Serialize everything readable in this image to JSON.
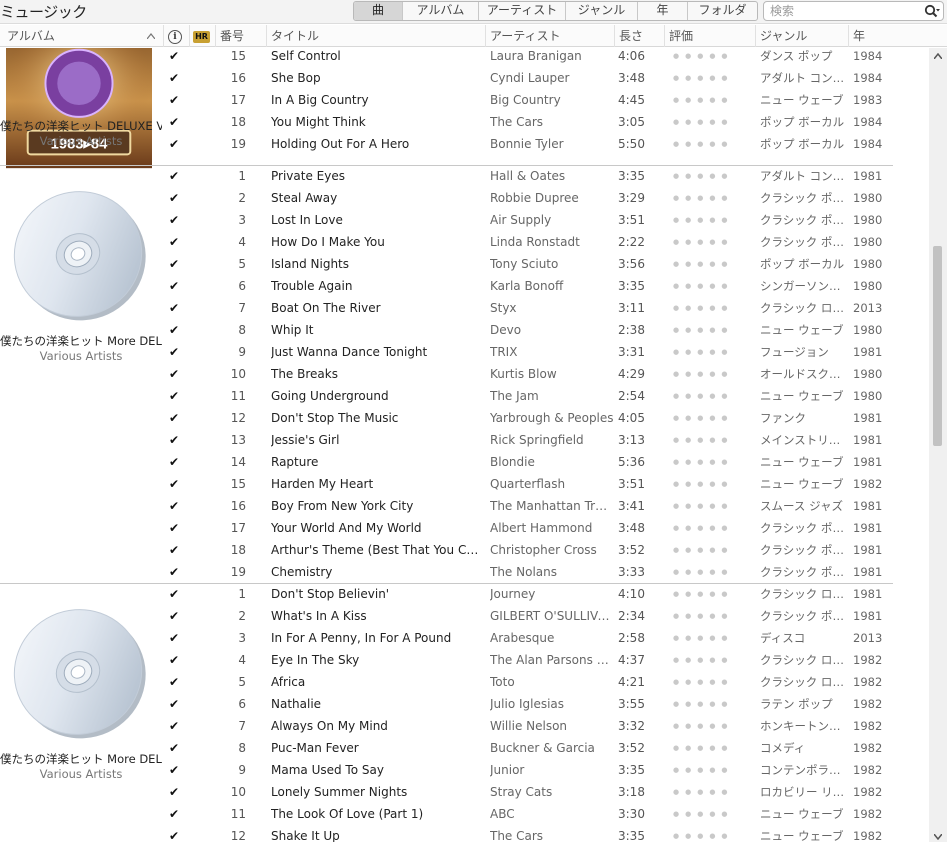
{
  "app": {
    "title": "ミュージック"
  },
  "view_tabs": [
    {
      "label": "曲",
      "active": true
    },
    {
      "label": "アルバム",
      "active": false
    },
    {
      "label": "アーティスト",
      "active": false
    },
    {
      "label": "ジャンル",
      "active": false
    },
    {
      "label": "年",
      "active": false
    },
    {
      "label": "フォルダ",
      "active": false
    }
  ],
  "search": {
    "placeholder": "検索",
    "value": ""
  },
  "columns": {
    "album": "アルバム",
    "hr": "HR",
    "track_no": "番号",
    "title": "タイトル",
    "artist": "アーティスト",
    "length": "長さ",
    "rating": "評価",
    "genre": "ジャンル",
    "year": "年"
  },
  "rating_dots": "●●●●●",
  "check_mark": "✔",
  "groups": [
    {
      "album": "僕たちの洋楽ヒット DELUXE V...",
      "artist": "Various Artists",
      "artwork": "album-cover-1983-84",
      "artwork_text": "1983▸84",
      "tracks": [
        {
          "no": "15",
          "title": "Self Control",
          "artist": "Laura Branigan",
          "length": "4:06",
          "genre": "ダンス ポップ",
          "year": "1984"
        },
        {
          "no": "16",
          "title": "She Bop",
          "artist": "Cyndi Lauper",
          "length": "3:48",
          "genre": "アダルト コンテン...",
          "year": "1984"
        },
        {
          "no": "17",
          "title": "In A Big Country",
          "artist": "Big Country",
          "length": "4:45",
          "genre": "ニュー ウェーブ",
          "year": "1983"
        },
        {
          "no": "18",
          "title": "You Might Think",
          "artist": "The Cars",
          "length": "3:05",
          "genre": "ポップ ボーカル",
          "year": "1984"
        },
        {
          "no": "19",
          "title": "Holding Out For A Hero",
          "artist": "Bonnie Tyler",
          "length": "5:50",
          "genre": "ポップ ボーカル",
          "year": "1984"
        }
      ]
    },
    {
      "album": "僕たちの洋楽ヒット More DEL...",
      "artist": "Various Artists",
      "artwork": "cd-disc",
      "tracks": [
        {
          "no": "1",
          "title": "Private Eyes",
          "artist": "Hall & Oates",
          "length": "3:35",
          "genre": "アダルト コンテン...",
          "year": "1981"
        },
        {
          "no": "2",
          "title": "Steal Away",
          "artist": "Robbie Dupree",
          "length": "3:29",
          "genre": "クラシック ポップ...",
          "year": "1980"
        },
        {
          "no": "3",
          "title": "Lost In Love",
          "artist": "Air Supply",
          "length": "3:51",
          "genre": "クラシック ポップ...",
          "year": "1980"
        },
        {
          "no": "4",
          "title": "How Do I Make You",
          "artist": "Linda Ronstadt",
          "length": "2:22",
          "genre": "クラシック ポップ...",
          "year": "1980"
        },
        {
          "no": "5",
          "title": "Island Nights",
          "artist": "Tony Sciuto",
          "length": "3:56",
          "genre": "ポップ ボーカル",
          "year": "1980"
        },
        {
          "no": "6",
          "title": "Trouble Again",
          "artist": "Karla Bonoff",
          "length": "3:35",
          "genre": "シンガーソングラ...",
          "year": "1980"
        },
        {
          "no": "7",
          "title": "Boat On The River",
          "artist": "Styx",
          "length": "3:11",
          "genre": "クラシック ロック",
          "year": "2013"
        },
        {
          "no": "8",
          "title": "Whip It",
          "artist": "Devo",
          "length": "2:38",
          "genre": "ニュー ウェーブ",
          "year": "1980"
        },
        {
          "no": "9",
          "title": "Just Wanna Dance Tonight",
          "artist": "TRIX",
          "length": "3:31",
          "genre": "フュージョン",
          "year": "1981"
        },
        {
          "no": "10",
          "title": "The Breaks",
          "artist": "Kurtis Blow",
          "length": "4:29",
          "genre": "オールドスクール ...",
          "year": "1980"
        },
        {
          "no": "11",
          "title": "Going Underground",
          "artist": "The Jam",
          "length": "2:54",
          "genre": "ニュー ウェーブ",
          "year": "1980"
        },
        {
          "no": "12",
          "title": "Don't Stop The Music",
          "artist": "Yarbrough & Peoples",
          "length": "4:05",
          "genre": "ファンク",
          "year": "1981"
        },
        {
          "no": "13",
          "title": "Jessie's Girl",
          "artist": "Rick Springfield",
          "length": "3:13",
          "genre": "メインストリーム ...",
          "year": "1981"
        },
        {
          "no": "14",
          "title": "Rapture",
          "artist": "Blondie",
          "length": "5:36",
          "genre": "ニュー ウェーブ",
          "year": "1981"
        },
        {
          "no": "15",
          "title": "Harden My Heart",
          "artist": "Quarterflash",
          "length": "3:51",
          "genre": "ニュー ウェーブ",
          "year": "1982"
        },
        {
          "no": "16",
          "title": "Boy From New York City",
          "artist": "The Manhattan Trans...",
          "length": "3:41",
          "genre": "スムース ジャズ",
          "year": "1981"
        },
        {
          "no": "17",
          "title": "Your World And My World",
          "artist": "Albert Hammond",
          "length": "3:48",
          "genre": "クラシック ポップ...",
          "year": "1981"
        },
        {
          "no": "18",
          "title": "Arthur's Theme (Best That You Can Do)",
          "artist": "Christopher Cross",
          "length": "3:52",
          "genre": "クラシック ポップ...",
          "year": "1981"
        },
        {
          "no": "19",
          "title": "Chemistry",
          "artist": "The Nolans",
          "length": "3:33",
          "genre": "クラシック ポップ...",
          "year": "1981"
        }
      ]
    },
    {
      "album": "僕たちの洋楽ヒット More DEL...",
      "artist": "Various Artists",
      "artwork": "cd-disc",
      "tracks": [
        {
          "no": "1",
          "title": "Don't Stop Believin'",
          "artist": "Journey",
          "length": "4:10",
          "genre": "クラシック ロック",
          "year": "1981"
        },
        {
          "no": "2",
          "title": "What's In A Kiss",
          "artist": "GILBERT O'SULLIVAN",
          "length": "2:34",
          "genre": "クラシック ポップ...",
          "year": "1981"
        },
        {
          "no": "3",
          "title": "In For A Penny, In For A Pound",
          "artist": "Arabesque",
          "length": "2:58",
          "genre": "ディスコ",
          "year": "2013"
        },
        {
          "no": "4",
          "title": "Eye In The Sky",
          "artist": "The Alan Parsons Pro...",
          "length": "4:37",
          "genre": "クラシック ロック",
          "year": "1982"
        },
        {
          "no": "5",
          "title": "Africa",
          "artist": "Toto",
          "length": "4:21",
          "genre": "クラシック ロック",
          "year": "1982"
        },
        {
          "no": "6",
          "title": "Nathalie",
          "artist": "Julio Iglesias",
          "length": "3:55",
          "genre": "ラテン ポップ",
          "year": "1982"
        },
        {
          "no": "7",
          "title": "Always On My Mind",
          "artist": "Willie Nelson",
          "length": "3:32",
          "genre": "ホンキートンク &...",
          "year": "1982"
        },
        {
          "no": "8",
          "title": "Puc-Man Fever",
          "artist": "Buckner & Garcia",
          "length": "3:52",
          "genre": "コメディ",
          "year": "1982"
        },
        {
          "no": "9",
          "title": "Mama Used To Say",
          "artist": "Junior",
          "length": "3:35",
          "genre": "コンテンポラリー ...",
          "year": "1982"
        },
        {
          "no": "10",
          "title": "Lonely Summer Nights",
          "artist": "Stray Cats",
          "length": "3:18",
          "genre": "ロカビリー リバイ...",
          "year": "1982"
        },
        {
          "no": "11",
          "title": "The Look Of Love (Part 1)",
          "artist": "ABC",
          "length": "3:30",
          "genre": "ニュー ウェーブ",
          "year": "1982"
        },
        {
          "no": "12",
          "title": "Shake It Up",
          "artist": "The Cars",
          "length": "3:35",
          "genre": "ニュー ウェーブ",
          "year": "1982"
        }
      ]
    }
  ]
}
